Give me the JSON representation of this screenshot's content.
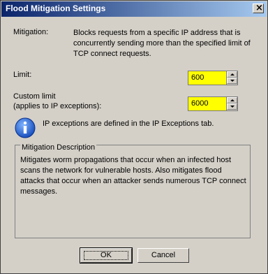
{
  "window": {
    "title": "Flood Mitigation Settings",
    "close_glyph": "×"
  },
  "mitigation": {
    "label": "Mitigation:",
    "description": "Blocks requests from a specific IP address that is concurrently sending more than the specified limit of TCP connect requests."
  },
  "limit": {
    "label": "Limit:",
    "value": "600"
  },
  "custom_limit": {
    "label_line1": "Custom limit",
    "label_line2": "(applies to IP exceptions):",
    "value": "6000"
  },
  "info": {
    "icon": "info-icon",
    "text": "IP exceptions are defined in the IP Exceptions tab."
  },
  "group": {
    "title": "Mitigation Description",
    "text": "Mitigates worm propagations that occur when an infected host scans the network for vulnerable hosts. Also mitigates flood attacks that occur when an attacker sends numerous TCP connect messages."
  },
  "buttons": {
    "ok": "OK",
    "cancel": "Cancel"
  },
  "colors": {
    "highlight": "#ffff00",
    "titlebar": "#0a246a",
    "dialog": "#d4d0c8"
  }
}
